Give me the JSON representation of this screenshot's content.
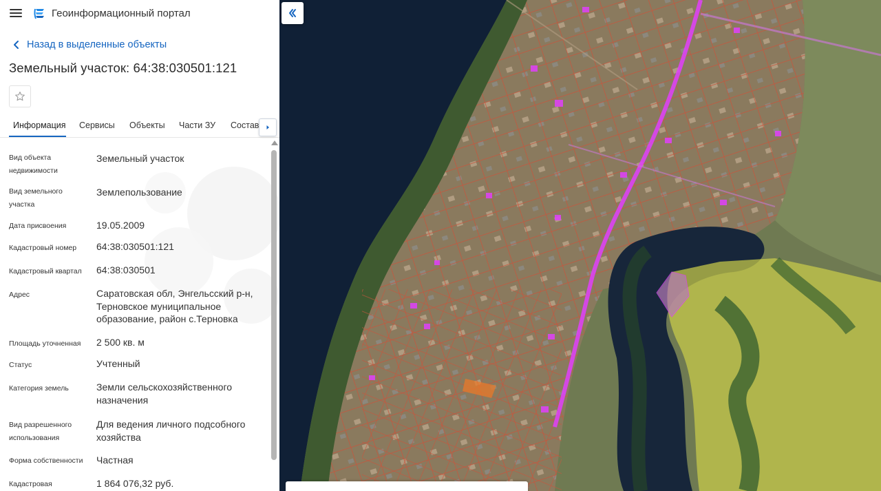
{
  "app": {
    "title": "Геоинформационный портал"
  },
  "nav": {
    "back_label": "Назад в выделенные объекты"
  },
  "page": {
    "title": "Земельный участок: 64:38:030501:121"
  },
  "tabs": [
    {
      "label": "Информация",
      "active": true
    },
    {
      "label": "Сервисы",
      "active": false
    },
    {
      "label": "Объекты",
      "active": false
    },
    {
      "label": "Части ЗУ",
      "active": false
    },
    {
      "label": "Состав",
      "active": false
    }
  ],
  "properties": [
    {
      "label": "Вид объекта недвижимости",
      "value": "Земельный участок"
    },
    {
      "label": "Вид земельного участка",
      "value": "Землепользование"
    },
    {
      "label": "Дата присвоения",
      "value": "19.05.2009"
    },
    {
      "label": "Кадастровый номер",
      "value": "64:38:030501:121"
    },
    {
      "label": "Кадастровый квартал",
      "value": "64:38:030501"
    },
    {
      "label": "Адрес",
      "value": "Саратовская обл, Энгельсский р-н, Терновское муниципальное образование, район с.Терновка"
    },
    {
      "label": "Площадь уточненная",
      "value": "2 500 кв. м"
    },
    {
      "label": "Статус",
      "value": "Учтенный"
    },
    {
      "label": "Категория земель",
      "value": "Земли сельскохозяйственного назначения"
    },
    {
      "label": "Вид разрешенного использования",
      "value": "Для ведения личного подсобного хозяйства"
    },
    {
      "label": "Форма собственности",
      "value": "Частная"
    },
    {
      "label": "Кадастровая",
      "value": "1 864 076,32 руб."
    }
  ],
  "colors": {
    "accent": "#1565c0",
    "parcel_highlight": "#e040fb",
    "parcel_border": "#d2553a",
    "agri_zone": "#d4d64a"
  },
  "icons": {
    "menu": "hamburger-icon",
    "logo": "portal-logo-icon",
    "back": "chevron-left-icon",
    "favorite": "star-outline-icon",
    "tabs_next": "chevron-right-icon",
    "collapse": "double-chevron-left-icon"
  }
}
